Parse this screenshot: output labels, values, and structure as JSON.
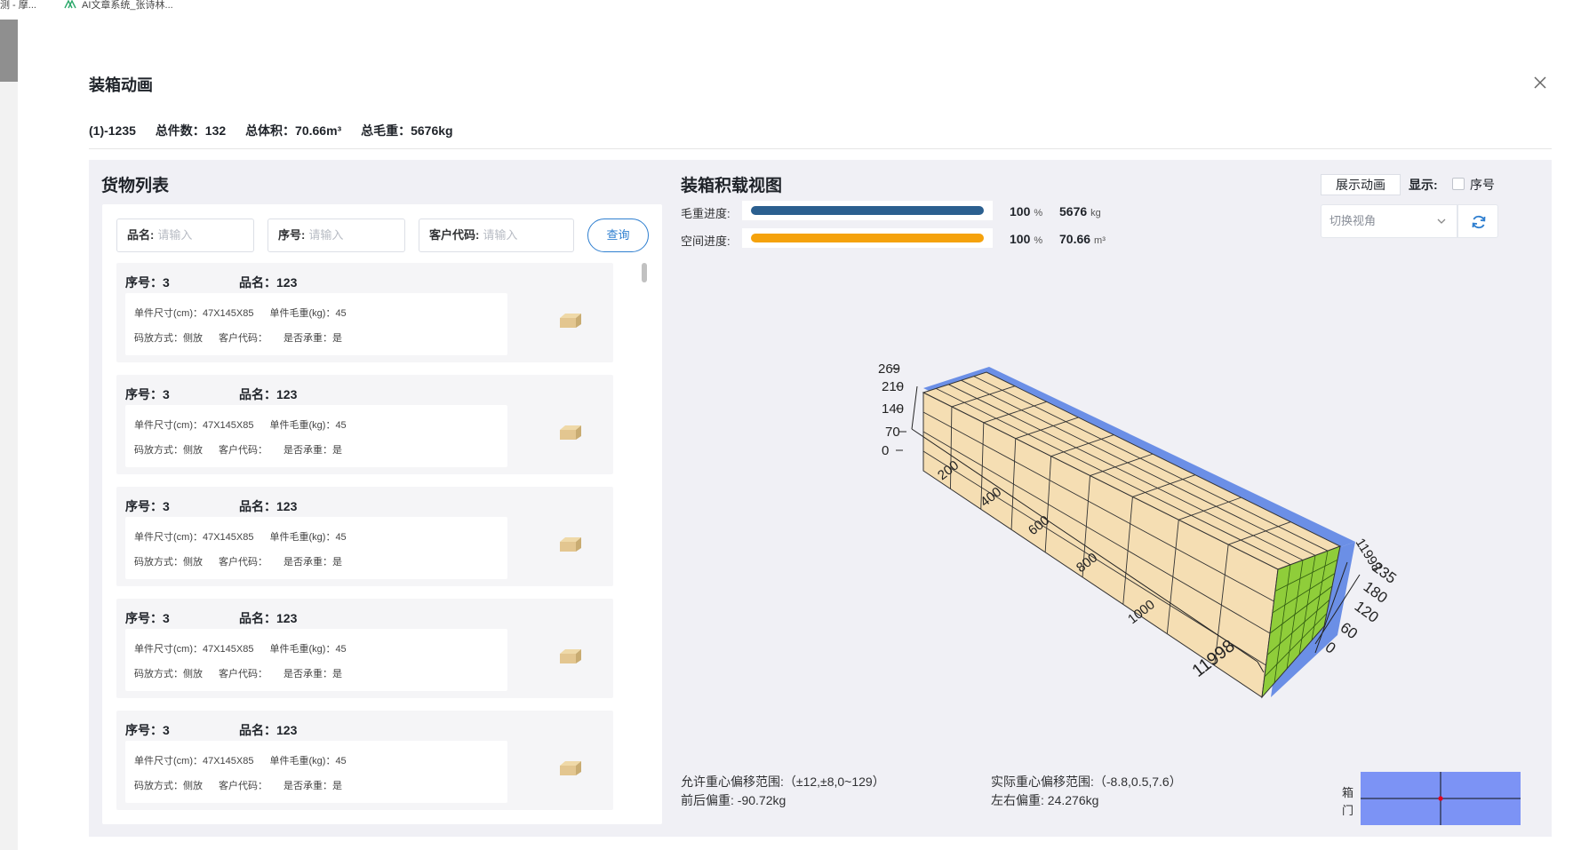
{
  "browser": {
    "bookmarks": [
      "测 - 摩...",
      "AI文章系统_张诗林..."
    ]
  },
  "dialog": {
    "title": "装箱动画",
    "close_icon": "close-icon"
  },
  "summary": {
    "id": "(1)-1235",
    "total_count": "总件数：132",
    "total_volume": "总体积：70.66m³",
    "total_weight": "总毛重：5676kg"
  },
  "goods": {
    "title": "货物列表",
    "filters": {
      "name_label": "品名:",
      "name_placeholder": "请输入",
      "seq_label": "序号:",
      "seq_placeholder": "请输入",
      "customer_label": "客户代码:",
      "customer_placeholder": "请输入",
      "query_label": "查询"
    },
    "items": [
      {
        "no": "序号：3",
        "name": "品名：123",
        "size": "单件尺寸(cm)：47X145X85",
        "weight": "单件毛重(kg)：45",
        "placement": "码放方式：侧放",
        "customer": "客户代码：",
        "bearing": "是否承重：是"
      },
      {
        "no": "序号：3",
        "name": "品名：123",
        "size": "单件尺寸(cm)：47X145X85",
        "weight": "单件毛重(kg)：45",
        "placement": "码放方式：侧放",
        "customer": "客户代码：",
        "bearing": "是否承重：是"
      },
      {
        "no": "序号：3",
        "name": "品名：123",
        "size": "单件尺寸(cm)：47X145X85",
        "weight": "单件毛重(kg)：45",
        "placement": "码放方式：侧放",
        "customer": "客户代码：",
        "bearing": "是否承重：是"
      },
      {
        "no": "序号：3",
        "name": "品名：123",
        "size": "单件尺寸(cm)：47X145X85",
        "weight": "单件毛重(kg)：45",
        "placement": "码放方式：侧放",
        "customer": "客户代码：",
        "bearing": "是否承重：是"
      },
      {
        "no": "序号：3",
        "name": "品名：123",
        "size": "单件尺寸(cm)：47X145X85",
        "weight": "单件毛重(kg)：45",
        "placement": "码放方式：侧放",
        "customer": "客户代码：",
        "bearing": "是否承重：是"
      }
    ]
  },
  "view": {
    "title": "装箱积载视图",
    "animate_button": "展示动画",
    "show_label": "显示:",
    "seq_checkbox_label": "序号",
    "seq_checkbox_checked": false,
    "angle_select_placeholder": "切换视角",
    "refresh_icon": "refresh-icon",
    "weight_progress": {
      "label": "毛重进度:",
      "percent": 100,
      "pct_text": "100",
      "pct_unit": "%",
      "value": "5676",
      "unit": "kg",
      "color": "#2b5f8f"
    },
    "volume_progress": {
      "label": "空间进度:",
      "percent": 100,
      "pct_text": "100",
      "pct_unit": "%",
      "value": "70.66",
      "unit": "m³",
      "color": "#f5a20c"
    },
    "axes": {
      "height_ticks": [
        "269",
        "210",
        "140",
        "70",
        "0"
      ],
      "length_ticks": [
        "0",
        "200",
        "400",
        "600",
        "800",
        "1000",
        "11998"
      ],
      "width_ticks": [
        "0",
        "60",
        "120",
        "180",
        "235"
      ],
      "width_end_label": "11998"
    },
    "colors": {
      "container": "#6b8fe6",
      "cargo": "#f5deb3",
      "door_cargo": "#8fcd3a",
      "door_map": "#7c93f5",
      "cog_point": "#e6001e"
    },
    "cog": {
      "allowed_range": "允许重心偏移范围:（±12,±8,0~129）",
      "front_back": "前后偏重:   -90.72kg",
      "actual_range": "实际重心偏移范围:（-8.8,0.5,7.6）",
      "left_right": "左右偏重:   24.276kg",
      "door_label_1": "箱",
      "door_label_2": "门"
    }
  }
}
